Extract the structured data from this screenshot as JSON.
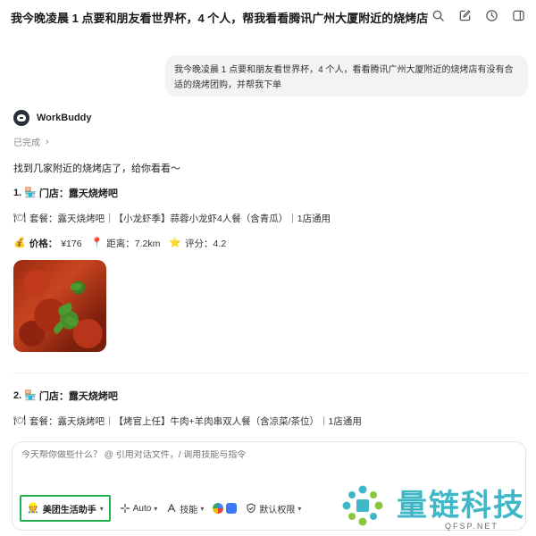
{
  "header": {
    "title": "我今晚凌晨 1 点要和朋友看世界杯，4 个人，帮我看看腾讯广州大厦附近的烧烤店",
    "icons": [
      "search-icon",
      "edit-icon",
      "history-icon",
      "panel-icon"
    ]
  },
  "user_message": "我今晚凌晨 1 点要和朋友看世界杯，4 个人，看看腾讯广州大厦附近的烧烤店有没有合适的烧烤团购，并帮我下单",
  "bot": {
    "name": "WorkBuddy",
    "status": "已完成",
    "intro": "找到几家附近的烧烤店了，给你看看～"
  },
  "stores": [
    {
      "index": "1.",
      "store_label": "门店：露天烧烤吧",
      "deal": "套餐：露天烧烤吧｜【小龙虾季】蒜蓉小龙虾4人餐（含青瓜）｜1店通用",
      "price_label": "价格：",
      "price": "¥176",
      "distance": "距离：7.2km",
      "rating": "评分：4.2"
    },
    {
      "index": "2.",
      "store_label": "门店：露天烧烤吧",
      "deal": "套餐：露天烧烤吧｜【烤官上任】牛肉+羊肉串双人餐（含凉菜/茶位）｜1店通用"
    }
  ],
  "composer": {
    "placeholder": "今天帮你做些什么？ @ 引用对话文件，/ 调用技能与指令",
    "agent": "美团生活助手",
    "mode": "Auto",
    "skills": "技能",
    "permission": "默认权限"
  },
  "watermark": {
    "text": "量链科技",
    "sub": "QFSP.NET"
  },
  "colors": {
    "agent_border": "#22b14c",
    "watermark": "#3fb7c6"
  }
}
